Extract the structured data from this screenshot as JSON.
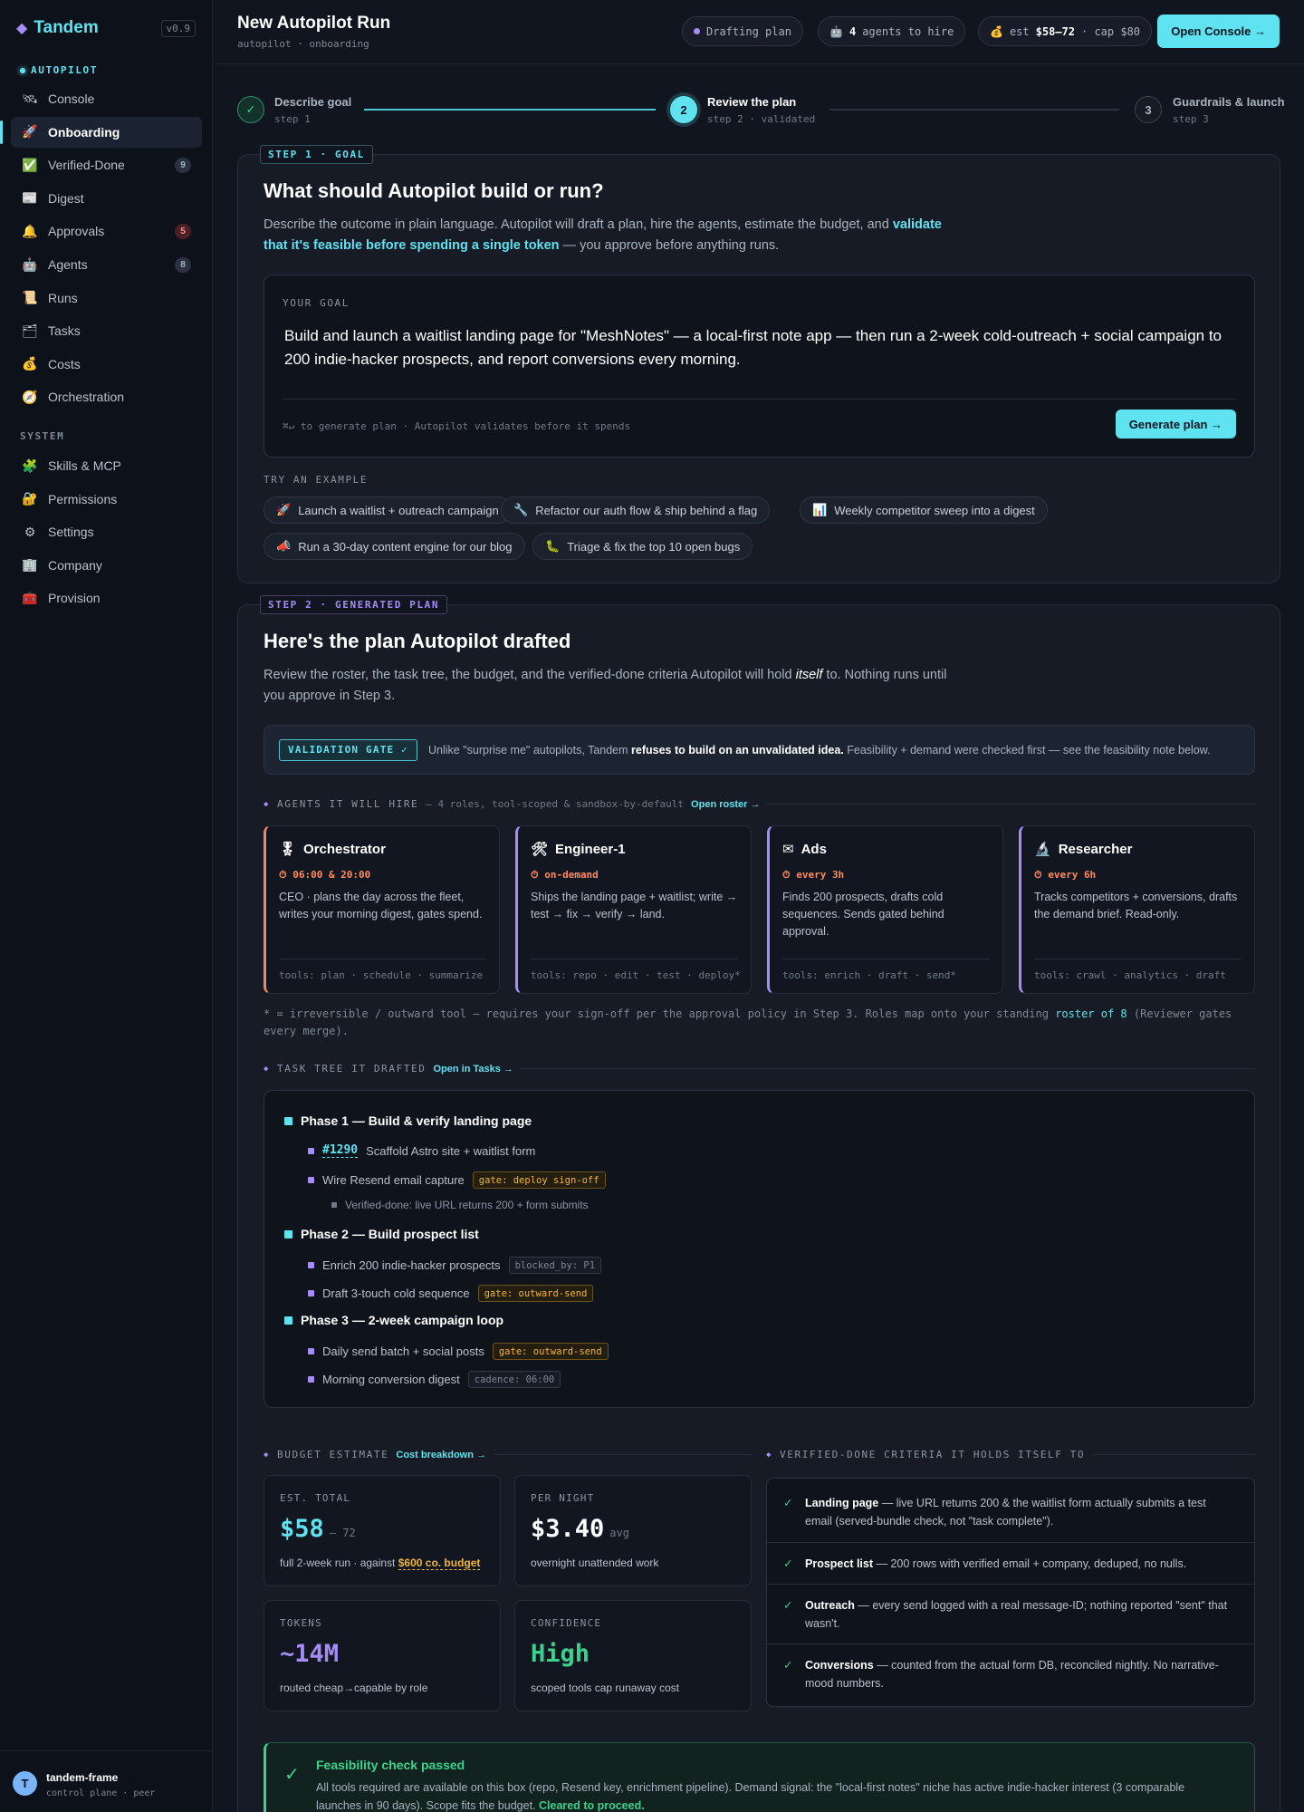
{
  "app": {
    "name": "Tandem",
    "version": "v0.9"
  },
  "sidebar": {
    "autopilot_label": "AUTOPILOT",
    "autopilot_items": [
      {
        "icon": "🛰",
        "icon_name": "satellite-icon",
        "label": "Console"
      },
      {
        "icon": "🚀",
        "icon_name": "rocket-icon",
        "label": "Onboarding",
        "active": true
      },
      {
        "icon": "✅",
        "icon_name": "check-icon",
        "label": "Verified-Done",
        "badge": "9"
      },
      {
        "icon": "📰",
        "icon_name": "newspaper-icon",
        "label": "Digest"
      },
      {
        "icon": "🔔",
        "icon_name": "bell-icon",
        "label": "Approvals",
        "badge": "5"
      },
      {
        "icon": "🤖",
        "icon_name": "robot-icon",
        "label": "Agents",
        "badge": "8"
      },
      {
        "icon": "📜",
        "icon_name": "scroll-icon",
        "label": "Runs"
      },
      {
        "icon": "🗂",
        "icon_name": "folder-icon",
        "label": "Tasks"
      },
      {
        "icon": "💰",
        "icon_name": "money-bag-icon",
        "label": "Costs"
      },
      {
        "icon": "🧭",
        "icon_name": "compass-icon",
        "label": "Orchestration"
      }
    ],
    "system_label": "SYSTEM",
    "system_items": [
      {
        "icon": "🧩",
        "icon_name": "puzzle-icon",
        "label": "Skills & MCP"
      },
      {
        "icon": "🔐",
        "icon_name": "lock-icon",
        "label": "Permissions"
      },
      {
        "icon": "⚙",
        "icon_name": "gear-icon",
        "label": "Settings"
      },
      {
        "icon": "🏢",
        "icon_name": "building-icon",
        "label": "Company"
      },
      {
        "icon": "🧰",
        "icon_name": "toolbox-icon",
        "label": "Provision"
      }
    ],
    "footer": {
      "avatar": "T",
      "name": "tandem-frame",
      "sub": "control plane · peer"
    }
  },
  "header": {
    "title": "New Autopilot Run",
    "breadcrumb": "autopilot · onboarding",
    "status": "Drafting plan",
    "agents_count": "4",
    "agents_text": "agents to hire",
    "est_label": "est",
    "est_value": "$58–72",
    "cap_text": "· cap $80",
    "console_button": "Open Console →"
  },
  "stepper": [
    {
      "mark": "✓",
      "title": "Describe goal",
      "sub": "step 1"
    },
    {
      "mark": "2",
      "title": "Review the plan",
      "sub": "step 2 · validated"
    },
    {
      "mark": "3",
      "title": "Guardrails & launch",
      "sub": "step 3"
    }
  ],
  "goal": {
    "tag": "STEP 1 · GOAL",
    "title": "What should Autopilot build or run?",
    "desc_pre": "Describe the outcome in plain language. Autopilot will draft a plan, hire the agents, estimate the budget, and ",
    "desc_hl": "validate that it's feasible before spending a single token",
    "desc_post": " — you approve before anything runs.",
    "box_label": "YOUR GOAL",
    "text": "Build and launch a waitlist landing page for \"MeshNotes\" — a local-first note app — then run a 2-week cold-outreach + social campaign to 200 indie-hacker prospects, and report conversions every morning.",
    "hint": "⌘↵ to generate plan · Autopilot validates before it spends",
    "generate_button": "Generate plan →",
    "examples_label": "TRY AN EXAMPLE",
    "examples": [
      {
        "icon": "🚀",
        "icon_name": "rocket-icon",
        "label": "Launch a waitlist + outreach campaign"
      },
      {
        "icon": "🔧",
        "icon_name": "wrench-icon",
        "label": "Refactor our auth flow & ship behind a flag"
      },
      {
        "icon": "📊",
        "icon_name": "bar-chart-icon",
        "label": "Weekly competitor sweep into a digest"
      },
      {
        "icon": "📣",
        "icon_name": "megaphone-icon",
        "label": "Run a 30-day content engine for our blog"
      },
      {
        "icon": "🐛",
        "icon_name": "bug-icon",
        "label": "Triage & fix the top 10 open bugs"
      }
    ]
  },
  "plan": {
    "tag": "STEP 2 · GENERATED PLAN",
    "title": "Here's the plan Autopilot drafted",
    "desc_pre": "Review the roster, the task tree, the budget, and the verified-done criteria Autopilot will hold ",
    "desc_em": "itself",
    "desc_post": " to. Nothing runs until you approve in Step 3.",
    "validation": {
      "chip": "VALIDATION GATE ✓",
      "pre": "Unlike \"surprise me\" autopilots, Tandem ",
      "strong": "refuses to build on an unvalidated idea.",
      "post": " Feasibility + demand were checked first — see the feasibility note below."
    },
    "agents_head": "AGENTS IT WILL HIRE",
    "agents_note": "— 4 roles, tool-scoped & sandbox-by-default",
    "agents_link": "Open roster →",
    "agents": [
      {
        "icon": "🎖",
        "icon_name": "medal-icon",
        "name": "Orchestrator",
        "schedule": "⏱ 06:00 & 20:00",
        "desc": "CEO · plans the day across the fleet, writes your morning digest, gates spend.",
        "tools": "tools: plan · schedule · summarize",
        "color": "#f08a5d"
      },
      {
        "icon": "🛠",
        "icon_name": "hammer-wrench-icon",
        "name": "Engineer-1",
        "schedule": "⏱ on-demand",
        "desc": "Ships the landing page + waitlist; write → test → fix → verify → land.",
        "tools": "tools: repo · edit · test · deploy*",
        "color": "#a68cf5"
      },
      {
        "icon": "✉",
        "icon_name": "envelope-icon",
        "name": "Ads",
        "schedule": "⏱ every 3h",
        "desc": "Finds 200 prospects, drafts cold sequences. Sends gated behind approval.",
        "tools": "tools: enrich · draft · send*",
        "color": "#a68cf5"
      },
      {
        "icon": "🔬",
        "icon_name": "microscope-icon",
        "name": "Researcher",
        "schedule": "⏱ every 6h",
        "desc": "Tracks competitors + conversions, drafts the demand brief. Read-only.",
        "tools": "tools: crawl · analytics · draft",
        "color": "#a68cf5"
      }
    ],
    "tool_note_pre": "* = irreversible / outward tool — requires your sign-off per the approval policy in Step 3. Roles map onto your standing ",
    "tool_note_link": "roster of 8",
    "tool_note_post": " (Reviewer gates every merge).",
    "tree_head": "TASK TREE IT DRAFTED",
    "tree_link": "Open in Tasks →",
    "tree": {
      "p1": "Phase 1 — Build & verify landing page",
      "t1_id": "#1290",
      "t1": "Scaffold Astro site + waitlist form",
      "t2": "Wire Resend email capture",
      "t2_gate": "gate: deploy sign-off",
      "t2_vd": "Verified-done: live URL returns 200 + form submits",
      "p2": "Phase 2 — Build prospect list",
      "t3": "Enrich 200 indie-hacker prospects",
      "t3_gate": "blocked_by: P1",
      "t4": "Draft 3-touch cold sequence",
      "t4_gate": "gate: outward-send",
      "p3": "Phase 3 — 2-week campaign loop",
      "t5": "Daily send batch + social posts",
      "t5_gate": "gate: outward-send",
      "t6": "Morning conversion digest",
      "t6_gate": "cadence: 06:00"
    },
    "budget_head": "BUDGET ESTIMATE",
    "budget_link": "Cost breakdown →",
    "metrics": {
      "total": {
        "label": "EST. TOTAL",
        "value": "$58",
        "suffix": "– 72",
        "sub_pre": "full 2-week run · against ",
        "sub_hl": "$600 co. budget",
        "color": "#5fe3f0"
      },
      "night": {
        "label": "PER NIGHT",
        "value": "$3.40",
        "suffix": "avg",
        "sub": "overnight unattended work",
        "color": "#ffffff"
      },
      "tokens": {
        "label": "TOKENS",
        "value": "~14M",
        "sub": "routed cheap→capable by role",
        "color": "#a68cf5"
      },
      "confidence": {
        "label": "CONFIDENCE",
        "value": "High",
        "sub": "scoped tools cap runaway cost",
        "color": "#3ad38e"
      }
    },
    "vd_head": "VERIFIED-DONE CRITERIA IT HOLDS ITSELF TO",
    "vd": [
      {
        "b": "Landing page",
        "t": " — live URL returns 200 & the waitlist form actually submits a test email (served-bundle check, not \"task complete\")."
      },
      {
        "b": "Prospect list",
        "t": " — 200 rows with verified email + company, deduped, no nulls."
      },
      {
        "b": "Outreach",
        "t": " — every send logged with a real message-ID; nothing reported \"sent\" that wasn't."
      },
      {
        "b": "Conversions",
        "t": " — counted from the actual form DB, reconciled nightly. No narrative-mood numbers."
      }
    ],
    "feasibility": {
      "title": "Feasibility check passed",
      "body": "All tools required are available on this box (repo, Resend key, enrichment pipeline). Demand signal: the \"local-first notes\" niche has active indie-hacker interest (3 comparable launches in 90 days). Scope fits the budget. ",
      "strong": "Cleared to proceed."
    }
  }
}
